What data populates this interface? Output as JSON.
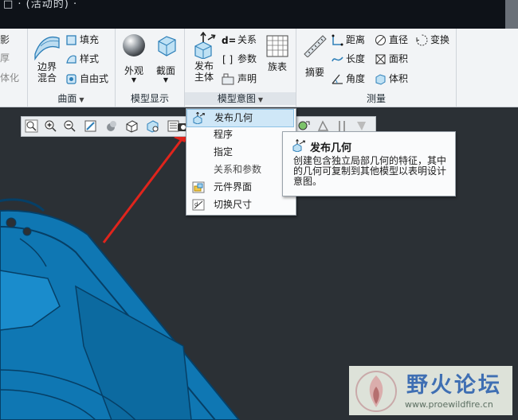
{
  "titlebar": {
    "text": "□ · (活动的) ·"
  },
  "ribbon": {
    "left_cut": {
      "items": [
        "影",
        "厚",
        "实体化"
      ]
    },
    "surface": {
      "label": "曲面",
      "blend": "边界\n混合",
      "fill": "填充",
      "style": "样式",
      "freeform": "自由式"
    },
    "model_display": {
      "label": "模型显示",
      "appearance": "外观",
      "section": "截面"
    },
    "model_intent": {
      "label": "模型意图",
      "publish": "发布\n主体",
      "relations": "关系",
      "params": "参数",
      "declare": "声明",
      "family": "族表"
    },
    "measure": {
      "label": "测量",
      "summary": "摘要",
      "distance": "距离",
      "diameter": "直径",
      "transform": "变换",
      "length": "长度",
      "area": "面积",
      "angle": "角度",
      "volume": "体积"
    }
  },
  "menu": {
    "items": [
      {
        "label": "发布几何",
        "state": "highlighted",
        "icon": "publish-geometry-icon"
      },
      {
        "label": "程序",
        "state": "normal",
        "icon": ""
      },
      {
        "label": "指定",
        "state": "normal",
        "icon": ""
      },
      {
        "label": "关系和参数",
        "state": "disabled",
        "icon": ""
      },
      {
        "label": "元件界面",
        "state": "normal",
        "icon": "component-interface-icon"
      },
      {
        "label": "切换尺寸",
        "state": "normal",
        "icon": "switch-dimension-icon"
      }
    ]
  },
  "tooltip": {
    "title": "发布几何",
    "description": "创建包含独立局部几何的特征，其中的几何可复制到其他模型以表明设计意图。"
  },
  "watermark": {
    "title": "野火论坛",
    "url": "www.proewildfire.cn"
  },
  "colors": {
    "ribbon_bg": "#f2f4f6",
    "viewport_bg": "#2b3035",
    "part_blue": "#0f77b3",
    "arrow_red": "#e0241c",
    "menu_highlight": "#cfe7f7"
  }
}
